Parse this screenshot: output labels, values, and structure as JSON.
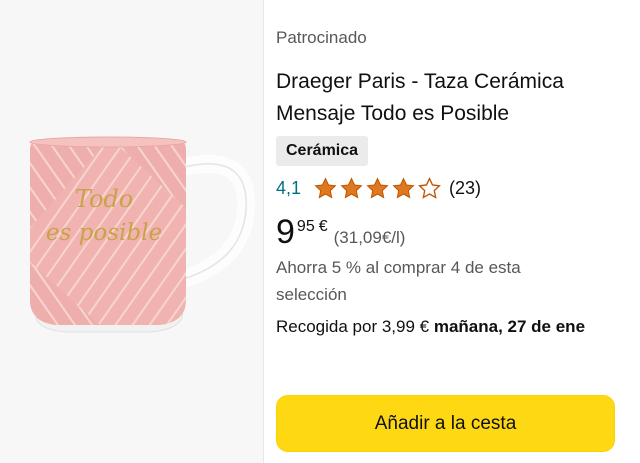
{
  "product": {
    "sponsored_label": "Patrocinado",
    "title": "Draeger Paris - Taza Cerámica Mensaje Todo es Posible",
    "material_tag": "Cerámica",
    "image_alt": "pink-mug-image",
    "mug_text_line1": "Todo",
    "mug_text_line2": "es posible"
  },
  "rating": {
    "value": "4,1",
    "stars": 4.1,
    "count": "(23)",
    "star_color": "#de7921",
    "link_color": "#007185"
  },
  "price": {
    "whole": "9",
    "fraction": "95",
    "currency": "€",
    "unit_price": "(31,09€/l)"
  },
  "promo": {
    "text": "Ahorra 5 % al comprar 4 de esta selección"
  },
  "delivery": {
    "prefix": "Recogida por 3,99 € ",
    "date": "mañana, 27 de ene"
  },
  "actions": {
    "add_to_cart_label": "Añadir a la cesta",
    "button_color": "#ffd814"
  }
}
